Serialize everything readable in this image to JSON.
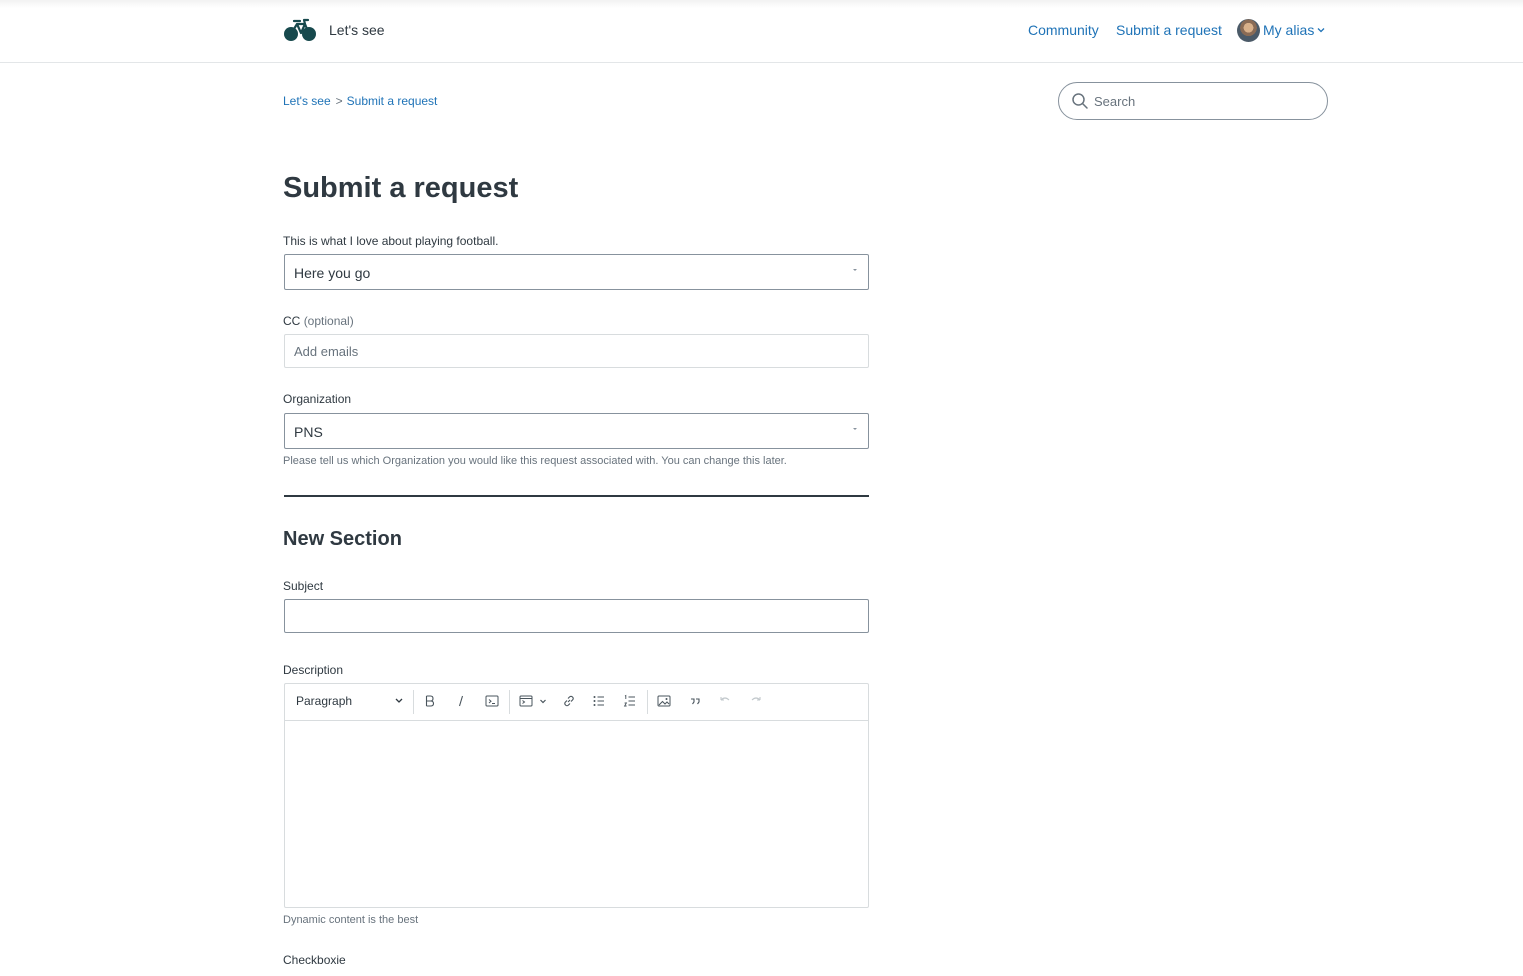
{
  "header": {
    "brand": "Let's see",
    "nav": {
      "community": "Community",
      "submit_request": "Submit a request"
    },
    "user": {
      "alias": "My alias"
    }
  },
  "breadcrumb": {
    "home": "Let's see",
    "separator": ">",
    "current": "Submit a request"
  },
  "search": {
    "placeholder": "Search"
  },
  "page": {
    "title": "Submit a request"
  },
  "form": {
    "ticket_form": {
      "label": "This is what I love about playing football.",
      "value": "Here you go"
    },
    "cc": {
      "label": "CC",
      "optional": "(optional)",
      "placeholder": "Add emails"
    },
    "organization": {
      "label": "Organization",
      "value": "PNS",
      "hint": "Please tell us which Organization you would like this request associated with. You can change this later."
    },
    "section": {
      "title": "New Section"
    },
    "subject": {
      "label": "Subject",
      "value": ""
    },
    "description": {
      "label": "Description",
      "block_format": "Paragraph",
      "hint": "Dynamic content is the best",
      "toolbar": [
        "bold-icon",
        "italic-icon",
        "code-icon",
        "code-block-icon",
        "link-icon",
        "bulleted-list-icon",
        "numbered-list-icon",
        "image-icon",
        "quote-icon",
        "undo-icon",
        "redo-icon"
      ]
    },
    "checkbox": {
      "label": "Checkboxie"
    }
  },
  "colors": {
    "link": "#1f73b7",
    "text": "#2f3941",
    "muted": "#68737d",
    "border": "#87929d",
    "divider": "#2f3941"
  }
}
